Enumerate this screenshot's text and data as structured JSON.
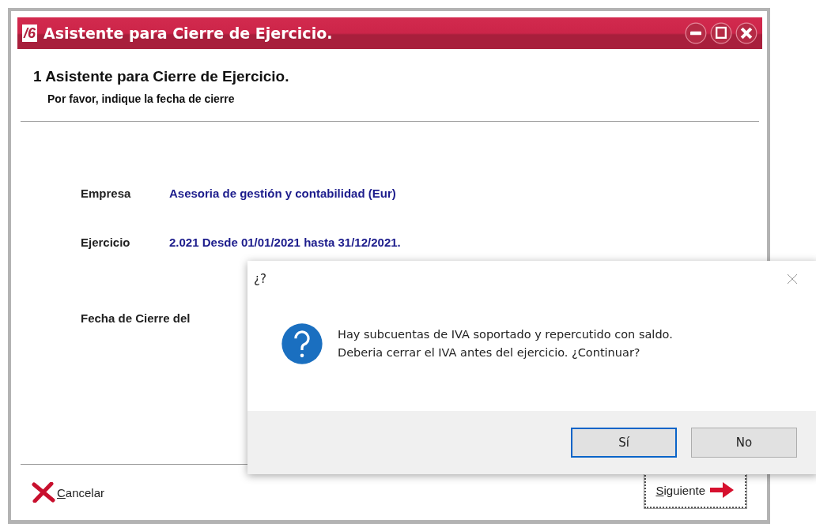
{
  "window": {
    "title": "Asistente para Cierre de Ejercicio.",
    "logo": "/6"
  },
  "wizard": {
    "step_title": "1 Asistente para Cierre de Ejercicio.",
    "step_subtitle": "Por favor, indique la fecha de cierre",
    "fields": [
      {
        "label": "Empresa",
        "value": "Asesoria de gestión y contabilidad (Eur)"
      },
      {
        "label": "Ejercicio",
        "value": "2.021 Desde 01/01/2021 hasta 31/12/2021."
      },
      {
        "label": "Fecha de Cierre del"
      }
    ],
    "buttons": [
      {
        "kind": "cancel",
        "label": "Cancelar"
      },
      {
        "kind": "next",
        "label": "Siguiente"
      }
    ]
  },
  "dialog": {
    "title": "¿?",
    "message": [
      "Hay subcuentas de IVA soportado y repercutido con saldo.",
      "Deberia cerrar el IVA antes del ejercicio. ¿Continuar?"
    ],
    "buttons": [
      {
        "label": "Sí",
        "selected": true
      },
      {
        "label": "No",
        "selected": false
      }
    ]
  }
}
